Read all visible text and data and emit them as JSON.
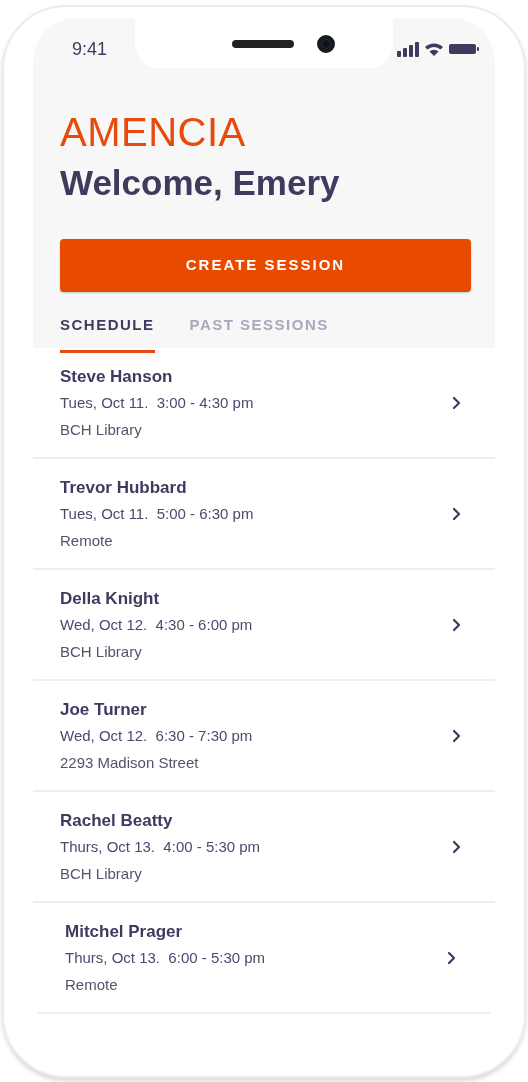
{
  "status_bar": {
    "time": "9:41"
  },
  "brand": "AMENCIA",
  "greeting": "Welcome, Emery",
  "primary_button": "CREATE SESSION",
  "tabs": [
    {
      "label": "SCHEDULE",
      "selected": true
    },
    {
      "label": "PAST SESSIONS",
      "selected": false
    }
  ],
  "sessions": [
    {
      "name": "Steve Hanson",
      "when": "Tues, Oct 11.  3:00 - 4:30 pm",
      "where": "BCH Library"
    },
    {
      "name": "Trevor Hubbard",
      "when": "Tues, Oct 11.  5:00 - 6:30 pm",
      "where": "Remote"
    },
    {
      "name": "Della Knight",
      "when": "Wed, Oct 12.  4:30 - 6:00 pm",
      "where": "BCH Library"
    },
    {
      "name": "Joe Turner",
      "when": "Wed, Oct 12.  6:30 - 7:30 pm",
      "where": "2293 Madison Street"
    },
    {
      "name": "Rachel Beatty",
      "when": "Thurs, Oct 13.  4:00 - 5:30 pm",
      "where": "BCH Library"
    },
    {
      "name": "Mitchel Prager",
      "when": "Thurs, Oct 13.  6:00 - 5:30 pm",
      "where": "Remote"
    }
  ]
}
